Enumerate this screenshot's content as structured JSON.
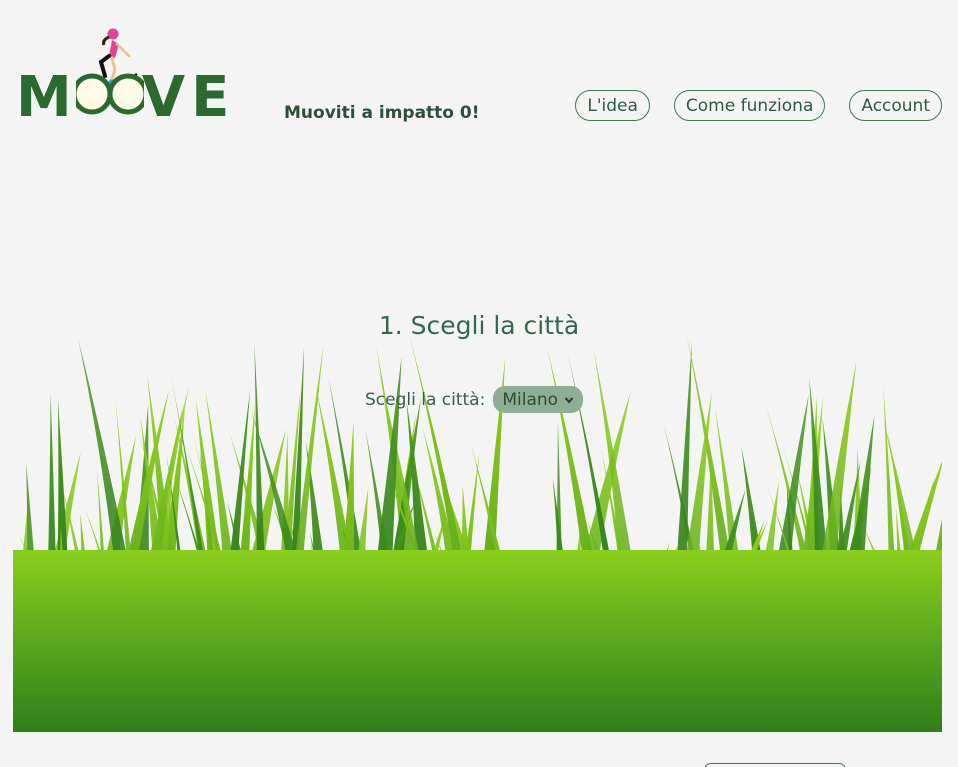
{
  "brand": {
    "logo_text": "MOOVE",
    "tagline": "Muoviti a impatto 0!"
  },
  "nav": {
    "items": [
      {
        "label": "L'idea"
      },
      {
        "label": "Come funziona"
      },
      {
        "label": "Account"
      }
    ]
  },
  "step": {
    "title": "1. Scegli la città",
    "city_label": "Scegli la città:",
    "city_value": "Milano"
  },
  "icons": {
    "logo": "cyclist-logo-icon",
    "select": "chevron-down-icon",
    "hero": "grass-illustration"
  },
  "colors": {
    "brand": "#2a6a2f",
    "accent": "#3b7a4f",
    "select_bg": "#8eae95",
    "grass_light": "#7bc41a",
    "grass_dark": "#2f8a1f"
  }
}
